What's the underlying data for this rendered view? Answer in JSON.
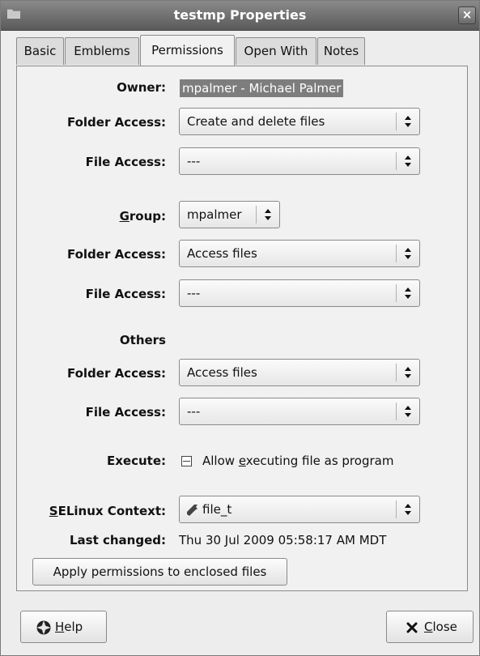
{
  "window": {
    "title": "testmp Properties",
    "close_symbol": "×"
  },
  "tabs": [
    {
      "label": "Basic",
      "active": false
    },
    {
      "label": "Emblems",
      "active": false
    },
    {
      "label": "Permissions",
      "active": true
    },
    {
      "label": "Open With",
      "active": false
    },
    {
      "label": "Notes",
      "active": false
    }
  ],
  "owner": {
    "label": "Owner:",
    "value": "mpalmer - Michael Palmer",
    "folder_access_label": "Folder Access:",
    "folder_access": "Create and delete files",
    "file_access_label": "File Access:",
    "file_access": "---"
  },
  "group": {
    "label_mnemonic": "G",
    "label_rest": "roup:",
    "value": "mpalmer",
    "folder_access_label": "Folder Access:",
    "folder_access": "Access files",
    "file_access_label": "File Access:",
    "file_access": "---"
  },
  "others": {
    "heading": "Others",
    "folder_access_label": "Folder Access:",
    "folder_access": "Access files",
    "file_access_label": "File Access:",
    "file_access": "---"
  },
  "execute": {
    "label": "Execute:",
    "checkbox_pre": "Allow ",
    "checkbox_mnemonic": "e",
    "checkbox_post": "xecuting file as program",
    "checked": false
  },
  "selinux": {
    "label_mnemonic": "S",
    "label_rest": "ELinux Context:",
    "value": "file_t",
    "icon": "wrench-icon"
  },
  "last_changed": {
    "label": "Last changed:",
    "value": "Thu 30 Jul 2009 05:58:17 AM MDT"
  },
  "apply_button": "Apply permissions to enclosed files",
  "footer": {
    "help_mnemonic": "H",
    "help_rest": "elp",
    "help_icon": "lifebuoy-icon",
    "close_mnemonic": "C",
    "close_rest": "lose",
    "close_icon": "x-icon"
  }
}
